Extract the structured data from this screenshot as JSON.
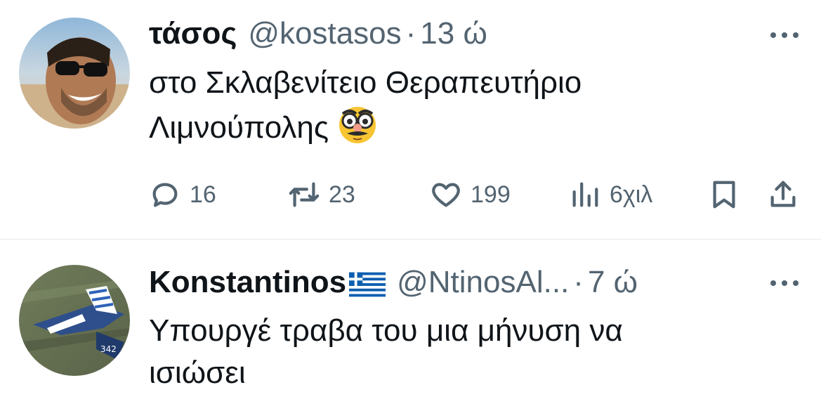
{
  "tweets": [
    {
      "name": "τάσος",
      "handle": "@kostasos",
      "separator": "·",
      "time": "13 ώ",
      "text_line1": "στο Σκλαβενίτειο Θεραπευτήριο",
      "text_line2": "Λιμνούπολης",
      "emoji": "disguised-face",
      "stats": {
        "replies": "16",
        "retweets": "23",
        "likes": "199",
        "views": "6χιλ"
      }
    },
    {
      "name": "Konstantinos",
      "flag": "greece-flag",
      "handle": "@NtinosAl...",
      "separator": "·",
      "time": "7 ώ",
      "text_line1": "Υπουργέ τραβα του μια μήνυση να",
      "text_line2": "ισιώσει"
    }
  ],
  "colors": {
    "text": "#0f1419",
    "secondary": "#536471",
    "divider": "#e6ecf0"
  },
  "icons": [
    "more-icon",
    "reply-icon",
    "retweet-icon",
    "like-icon",
    "views-icon",
    "bookmark-icon",
    "share-icon"
  ]
}
